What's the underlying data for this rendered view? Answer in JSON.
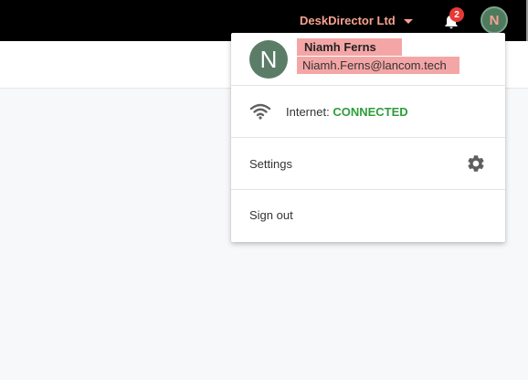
{
  "header": {
    "company": "DeskDirector Ltd",
    "notification_count": "2",
    "avatar_letter": "N"
  },
  "user_menu": {
    "avatar_letter": "N",
    "name": "Niamh Ferns",
    "email": "Niamh.Ferns@lancom.tech",
    "internet_label": "Internet:",
    "internet_status": "CONNECTED",
    "settings_label": "Settings",
    "signout_label": "Sign out"
  },
  "colors": {
    "accent": "#f6a38f",
    "redaction": "#f4a6a6",
    "connected": "#2e9d3b",
    "badge": "#e53935",
    "avatar": "#5b7d67"
  },
  "icons": [
    "caret-down-icon",
    "bell-icon",
    "wifi-icon",
    "gear-icon"
  ]
}
